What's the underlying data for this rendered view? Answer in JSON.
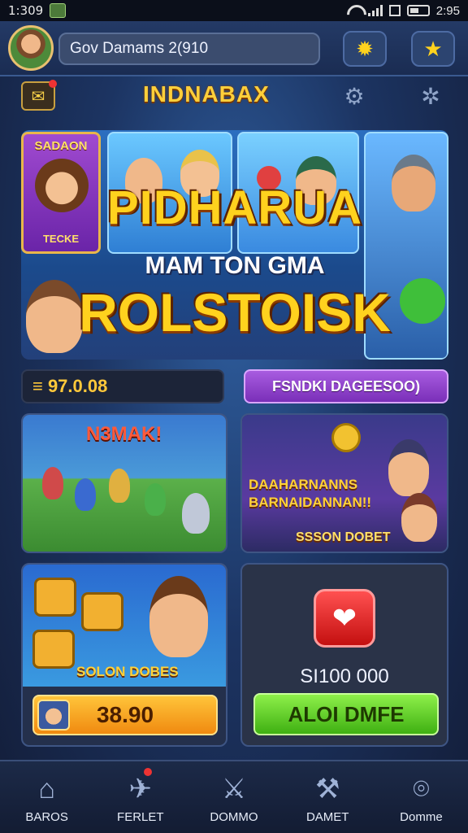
{
  "status_bar": {
    "time": "1:309",
    "battery_text": "2:95"
  },
  "top_bar": {
    "search_text": "Gov Damams 2(910",
    "icon_left": "gear-icon",
    "icon_right": "star-icon"
  },
  "sub_bar": {
    "title": "INDNABAX",
    "left_icon": "chest-icon",
    "icon_1": "settings-icon",
    "icon_2": "cog-icon"
  },
  "hero": {
    "season_card_top": "SADAON",
    "season_card_bottom": "TECKE",
    "title_line1": "PIDHARUA",
    "title_line2": "MAM TON GMA",
    "title_line3": "ROLSTOISK"
  },
  "balance": {
    "text": "≡ 97.0.08"
  },
  "purple_button": {
    "label": "FSNDKI DAGEESOO)"
  },
  "panel_battle": {
    "tag": "N3MAK!"
  },
  "panel_coins": {
    "headline_1": "DAAHARNANNS",
    "headline_2": "BARNAIDANNAN!!",
    "footer": "SSSON DOBET"
  },
  "panel_items": {
    "tag": "SOLON DOBES",
    "button_value": "38.90"
  },
  "panel_shop": {
    "price": "SI100 000",
    "button_label": "ALOI DMFE"
  },
  "colors": {
    "accent_gold": "#ffd21e",
    "purple": "#7a2fb8",
    "green": "#3fb012",
    "orange": "#f08a10",
    "red": "#c41010"
  },
  "bottom_nav": [
    {
      "label": "BAROS",
      "icon": "home-icon"
    },
    {
      "label": "FERLET",
      "icon": "fighter-icon"
    },
    {
      "label": "DOMMO",
      "icon": "sword-icon"
    },
    {
      "label": "DAMET",
      "icon": "anvil-icon"
    },
    {
      "label": "Domme",
      "icon": "lock-icon"
    }
  ]
}
